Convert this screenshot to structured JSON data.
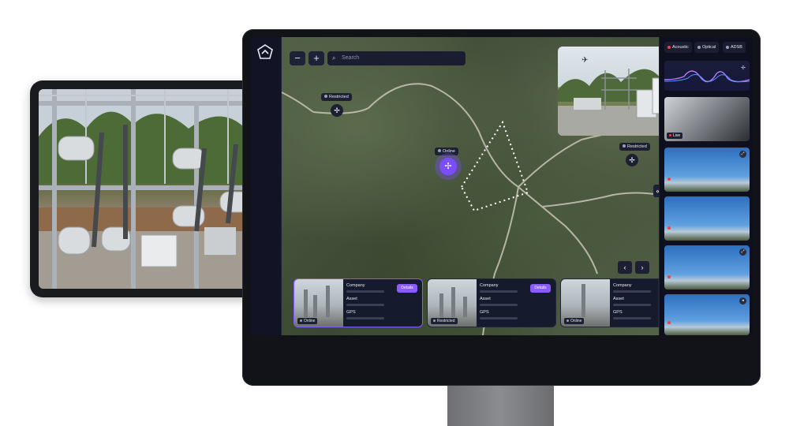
{
  "map": {
    "search_placeholder": "Search",
    "zoom_out_label": "−",
    "zoom_in_label": "+",
    "pins": [
      {
        "label": "Restricted",
        "status_color": "#9aa0b8"
      },
      {
        "label": "Online",
        "status_color": "#9aa0b8"
      },
      {
        "label": "Restricted",
        "status_color": "#9aa0b8"
      }
    ],
    "collapse_label": "«",
    "prev_label": "‹",
    "next_label": "›"
  },
  "cards": [
    {
      "company_label": "Company",
      "asset_label": "Asset",
      "gps_label": "GPS",
      "details_label": "Details",
      "status": "Online",
      "status_color": "#9aa0b8"
    },
    {
      "company_label": "Company",
      "asset_label": "Asset",
      "gps_label": "GPS",
      "details_label": "Details",
      "status": "Restricted",
      "status_color": "#9aa0b8"
    },
    {
      "company_label": "Company",
      "asset_label": "Asset",
      "gps_label": "GPS",
      "status": "Online",
      "status_color": "#9aa0b8"
    }
  ],
  "sensors": {
    "tabs": [
      {
        "label": "Acoustic",
        "dot_color": "#ff3b3b"
      },
      {
        "label": "Optical",
        "dot_color": "#9aa0b8"
      },
      {
        "label": "ADSB",
        "dot_color": "#9aa0b8"
      }
    ],
    "live_label": "Live"
  },
  "colors": {
    "accent": "#8a5cff",
    "alert": "#ff3b3b"
  }
}
